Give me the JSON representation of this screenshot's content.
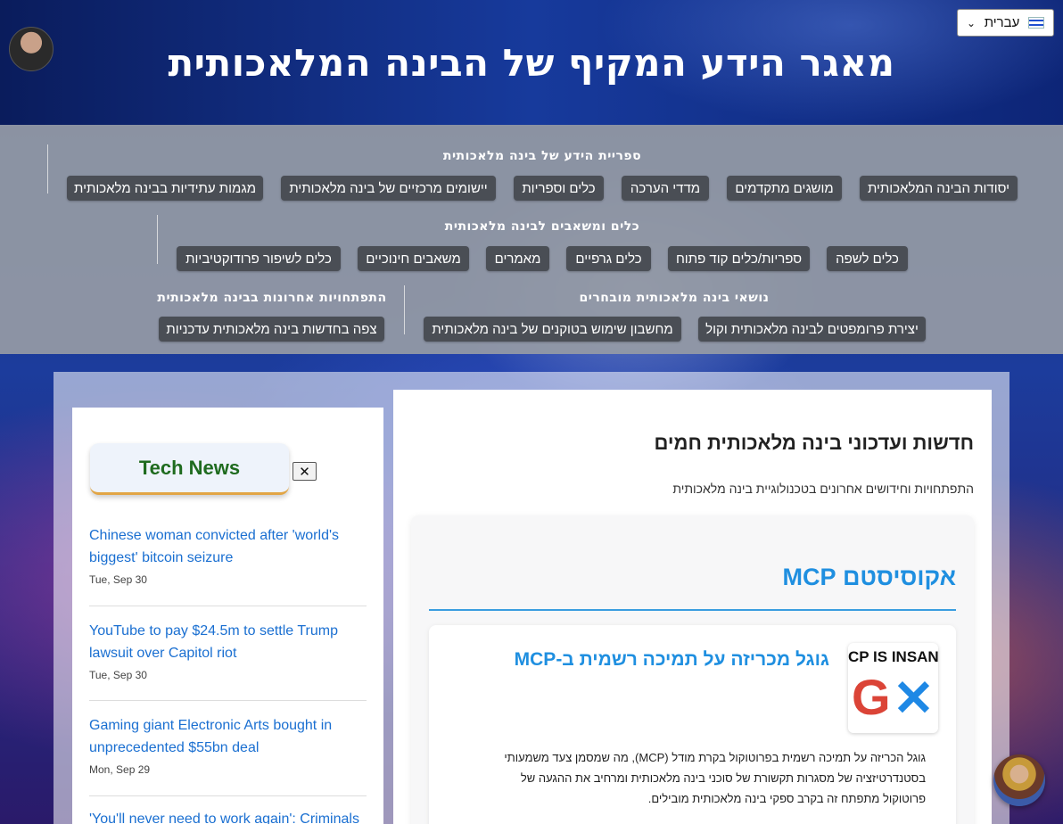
{
  "header": {
    "site_title": "מאגר הידע המקיף של הבינה המלאכותית",
    "language": "עברית"
  },
  "nav": {
    "sections": [
      {
        "heading": "ספריית הידע של בינה מלאכותית",
        "items": [
          "יסודות הבינה המלאכותית",
          "מושגים מתקדמים",
          "מדדי הערכה",
          "כלים וספריות",
          "יישומים מרכזיים של בינה מלאכותית",
          "מגמות עתידיות בבינה מלאכותית"
        ]
      },
      {
        "heading": "כלים ומשאבים לבינה מלאכותית",
        "items": [
          "כלים לשפה",
          "ספריות/כלים קוד פתוח",
          "כלים גרפיים",
          "מאמרים",
          "משאבים חינוכיים",
          "כלים לשיפור פרודוקטיביות"
        ]
      },
      {
        "heading": "נושאי בינה מלאכותית מובחרים",
        "items": [
          "יצירת פרומפטים לבינה מלאכותית וקול",
          "מחשבון שימוש בטוקנים של בינה מלאכותית"
        ]
      },
      {
        "heading": "התפתחויות אחרונות בבינה מלאכותית",
        "items": [
          "צפה בחדשות בינה מלאכותית עדכניות"
        ]
      }
    ]
  },
  "sidebar": {
    "badge": "Tech News",
    "close": "✕",
    "news": [
      {
        "title": "Chinese woman convicted after 'world's biggest' bitcoin seizure",
        "date": "Tue, Sep 30"
      },
      {
        "title": "YouTube to pay $24.5m to settle Trump lawsuit over Capitol riot",
        "date": "Tue, Sep 30"
      },
      {
        "title": "Gaming giant Electronic Arts bought in unprecedented $55bn deal",
        "date": "Mon, Sep 29"
      },
      {
        "title": "'You'll never need to work again': Criminals",
        "date": ""
      }
    ]
  },
  "main": {
    "title": "חדשות ועדכוני בינה מלאכותית חמים",
    "subtitle": "התפתחויות וחידושים אחרונים בטכנולוגיית בינה מלאכותית",
    "section_title": "אקוסיסטם MCP",
    "article": {
      "thumb_text": "CP IS INSAN",
      "title": "גוגל מכריזה על תמיכה רשמית ב-MCP",
      "body": "גוגל הכריזה על תמיכה רשמית בפרוטוקול בקרת מודל (MCP), מה שמסמן צעד משמעותי בסטנדרטיזציה של מסגרות תקשורת של סוכני בינה מלאכותית ומרחיב את ההגעה של פרוטוקול מתפתח זה בקרב ספקי בינה מלאכותית מובילים."
    }
  }
}
